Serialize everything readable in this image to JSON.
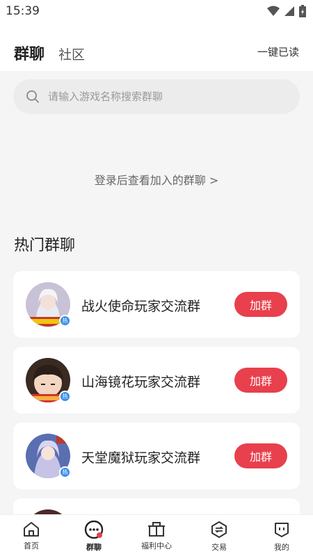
{
  "status_bar": {
    "time": "15:39"
  },
  "header": {
    "tabs": [
      {
        "label": "群聊"
      },
      {
        "label": "社区"
      }
    ],
    "mark_read": "一键已读"
  },
  "search": {
    "placeholder": "请输入游戏名称搜索群聊"
  },
  "login_hint": "登录后查看加入的群聊 >",
  "hot_section": {
    "title": "热门群聊",
    "groups": [
      {
        "name": "战火使命玩家交流群",
        "button": "加群",
        "badge": "热"
      },
      {
        "name": "山海镜花玩家交流群",
        "button": "加群",
        "badge": "热"
      },
      {
        "name": "天堂魔狱玩家交流群",
        "button": "加群",
        "badge": "热"
      }
    ]
  },
  "bottom_nav": {
    "items": [
      {
        "label": "首页"
      },
      {
        "label": "群聊"
      },
      {
        "label": "福利中心"
      },
      {
        "label": "交易"
      },
      {
        "label": "我的"
      }
    ]
  },
  "colors": {
    "accent": "#e8404c",
    "badge": "#3a8ee6",
    "background": "#f5f5f5"
  }
}
